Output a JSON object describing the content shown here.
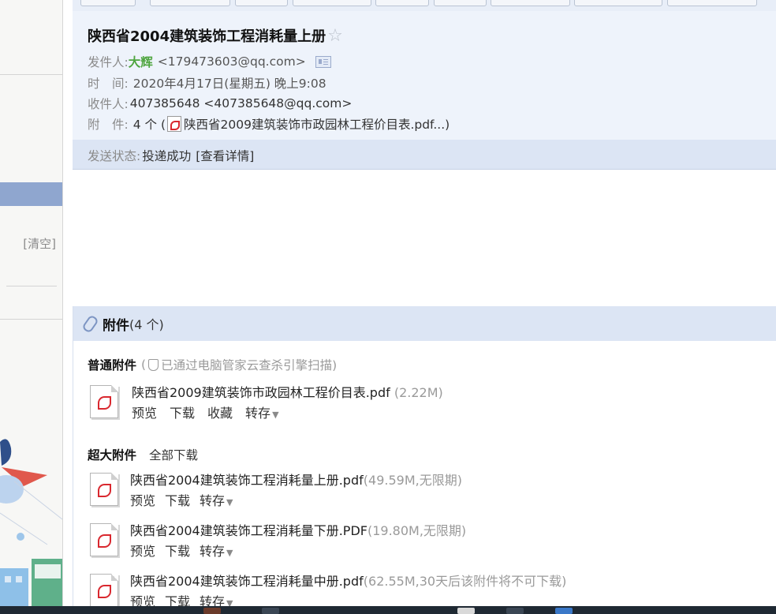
{
  "sidebar": {
    "clear_label": "[清空]"
  },
  "mail": {
    "subject": "陕西省2004建筑装饰工程消耗量上册",
    "star_icon": "☆",
    "from_label": "发件人:",
    "from_name": "大辉",
    "from_address": "<179473603@qq.com>",
    "time_label": "时　间:",
    "time_value": "2020年4月17日(星期五) 晚上9:08",
    "to_label": "收件人:",
    "to_value": "407385648 <407385648@qq.com>",
    "attach_label": "附　件:",
    "attach_summary_prefix": "4 个 (",
    "attach_summary_file": "陕西省2009建筑装饰市政园林工程价目表.pdf...)",
    "status_label": "发送状态:",
    "status_value": "投递成功",
    "status_detail_link": "[查看详情]"
  },
  "attachments": {
    "title": "附件",
    "count": "(4 个)",
    "normal_group": {
      "title": "普通附件",
      "note_open": "(",
      "note": "已通过电脑管家云查杀引擎扫描)",
      "files": [
        {
          "name": "陕西省2009建筑装饰市政园林工程价目表.pdf",
          "size": " (2.22M)",
          "actions": [
            "预览",
            "下载",
            "收藏",
            "转存"
          ]
        }
      ]
    },
    "large_group": {
      "title": "超大附件",
      "download_all": "全部下载",
      "files": [
        {
          "name": "陕西省2004建筑装饰工程消耗量上册.pdf",
          "size": "(49.59M,无限期)",
          "actions": [
            "预览",
            "下载",
            "转存"
          ]
        },
        {
          "name": "陕西省2004建筑装饰工程消耗量下册.PDF",
          "size": "(19.80M,无限期)",
          "actions": [
            "预览",
            "下载",
            "转存"
          ]
        },
        {
          "name": "陕西省2004建筑装饰工程消耗量中册.pdf",
          "size": "(62.55M,30天后该附件将不可下载)",
          "actions": [
            "预览",
            "下载",
            "转存"
          ]
        }
      ]
    }
  },
  "colors": {
    "header_bg": "#eef3fb",
    "status_bg": "#dce5f4",
    "sender_green": "#4ea53f",
    "pdf_red": "#d9282f",
    "sidebar_selected": "#8fa6cf"
  }
}
